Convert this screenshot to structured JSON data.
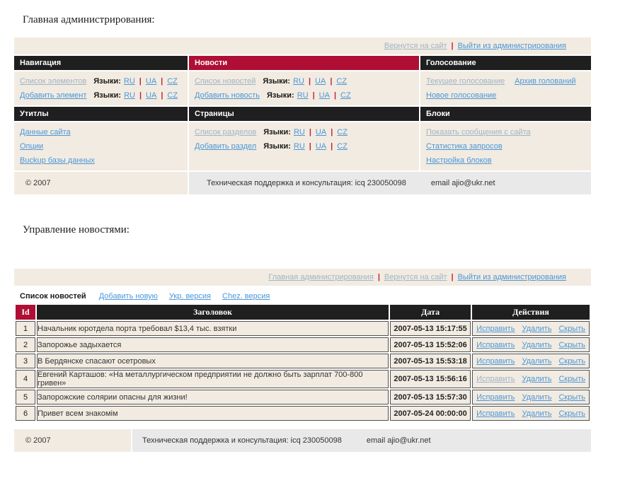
{
  "page": {
    "title_admin": "Главная администрирования:",
    "title_news": "Управление новостями:"
  },
  "colors": {
    "accent_red": "#af0e35",
    "header_dark": "#1f1f1f",
    "panel_beige": "#f2ebe1",
    "footer_gray": "#e9e9e9",
    "link_blue": "#4a97d9",
    "link_visited": "#9fb4c7",
    "separator_red": "#c0203a"
  },
  "admin_panel": {
    "topbar_links": [
      {
        "label": "Вернутся на сайт",
        "visited": true
      },
      {
        "label": "Выйти из администрирования",
        "visited": false
      }
    ],
    "languages_label": "Языки:",
    "section_rows": [
      [
        {
          "title": "Навигация",
          "accent": false,
          "items": [
            {
              "links": [
                {
                  "label": "Список элементов",
                  "visited": true
                }
              ],
              "languages": [
                "RU",
                "UA",
                "CZ"
              ]
            },
            {
              "links": [
                {
                  "label": "Добавить элемент",
                  "visited": false
                }
              ],
              "languages": [
                "RU",
                "UA",
                "CZ"
              ]
            }
          ]
        },
        {
          "title": "Новости",
          "accent": true,
          "items": [
            {
              "links": [
                {
                  "label": "Список новостей",
                  "visited": true
                }
              ],
              "languages": [
                "RU",
                "UA",
                "CZ"
              ]
            },
            {
              "links": [
                {
                  "label": "Добавить новость",
                  "visited": false
                }
              ],
              "languages": [
                "RU",
                "UA",
                "CZ"
              ]
            }
          ]
        },
        {
          "title": "Голосование",
          "accent": false,
          "items": [
            {
              "links": [
                {
                  "label": "Текущее голосование",
                  "visited": true
                },
                {
                  "label": "Архив голований",
                  "visited": false
                }
              ]
            },
            {
              "links": [
                {
                  "label": "Новое голосование",
                  "visited": false
                }
              ]
            }
          ]
        }
      ],
      [
        {
          "title": "Утитлы",
          "accent": false,
          "items": [
            {
              "links": [
                {
                  "label": "Данные сайта",
                  "visited": false
                }
              ]
            },
            {
              "links": [
                {
                  "label": "Опции",
                  "visited": false
                }
              ]
            },
            {
              "links": [
                {
                  "label": "Buckup базы данных",
                  "visited": false
                }
              ]
            }
          ]
        },
        {
          "title": "Страницы",
          "accent": false,
          "items": [
            {
              "links": [
                {
                  "label": "Список разделов",
                  "visited": true
                }
              ],
              "languages": [
                "RU",
                "UA",
                "CZ"
              ]
            },
            {
              "links": [
                {
                  "label": "Добавить раздел",
                  "visited": false
                }
              ],
              "languages": [
                "RU",
                "UA",
                "CZ"
              ]
            }
          ]
        },
        {
          "title": "Блоки",
          "accent": false,
          "items": [
            {
              "links": [
                {
                  "label": "Показать сообщения с сайта",
                  "visited": true
                }
              ]
            },
            {
              "links": [
                {
                  "label": "Статистика запросов",
                  "visited": false
                }
              ]
            },
            {
              "links": [
                {
                  "label": "Настройка блоков",
                  "visited": false
                }
              ]
            }
          ]
        }
      ]
    ],
    "footer": {
      "copyright": "© 2007",
      "support": "Техническая поддержка и консультация: icq 230050098",
      "email": "email ajio@ukr.net"
    }
  },
  "news_panel": {
    "topbar_links": [
      {
        "label": "Главная администрирования",
        "visited": true
      },
      {
        "label": "Вернутся на сайт",
        "visited": true
      },
      {
        "label": "Выйти из администрирования",
        "visited": false
      }
    ],
    "tabs": [
      {
        "label": "Список новостей",
        "active": true
      },
      {
        "label": "Добавить новую",
        "active": false
      },
      {
        "label": "Укр. версия",
        "active": false
      },
      {
        "label": "Chez. версия",
        "active": false
      }
    ],
    "table": {
      "headers": [
        "Id",
        "Заголовок",
        "Дата",
        "Действия"
      ],
      "rows": [
        {
          "id": "1",
          "title": "Начальник юротдела порта требовал $13,4 тыс. взятки",
          "date": "2007-05-13 15:17:55",
          "actions": [
            {
              "label": "Исправить",
              "visited": false
            },
            {
              "label": "Удалить",
              "visited": false
            },
            {
              "label": "Скрыть",
              "visited": false
            }
          ]
        },
        {
          "id": "2",
          "title": "Запорожье задыхается",
          "date": "2007-05-13 15:52:06",
          "actions": [
            {
              "label": "Исправить",
              "visited": false
            },
            {
              "label": "Удалить",
              "visited": false
            },
            {
              "label": "Скрыть",
              "visited": false
            }
          ]
        },
        {
          "id": "3",
          "title": "В Бердянске спасают осетровых",
          "date": "2007-05-13 15:53:18",
          "actions": [
            {
              "label": "Исправить",
              "visited": false
            },
            {
              "label": "Удалить",
              "visited": false
            },
            {
              "label": "Скрыть",
              "visited": false
            }
          ]
        },
        {
          "id": "4",
          "title": "Евгений Карташов: «На металлургическом предприятии не должно быть зарплат 700-800 гривен»",
          "date": "2007-05-13 15:56:16",
          "actions": [
            {
              "label": "Исправить",
              "visited": true
            },
            {
              "label": "Удалить",
              "visited": false
            },
            {
              "label": "Скрыть",
              "visited": false
            }
          ]
        },
        {
          "id": "5",
          "title": "Запорожские солярии опасны для жизни!",
          "date": "2007-05-13 15:57:30",
          "actions": [
            {
              "label": "Исправить",
              "visited": false
            },
            {
              "label": "Удалить",
              "visited": false
            },
            {
              "label": "Скрыть",
              "visited": false
            }
          ]
        },
        {
          "id": "6",
          "title": "Привет всем знакомім",
          "date": "2007-05-24 00:00:00",
          "actions": [
            {
              "label": "Исправить",
              "visited": false
            },
            {
              "label": "Удалить",
              "visited": false
            },
            {
              "label": "Скрыть",
              "visited": false
            }
          ]
        }
      ]
    },
    "footer": {
      "copyright": "© 2007",
      "support": "Техническая поддержка и консультация: icq 230050098",
      "email": "email ajio@ukr.net"
    }
  }
}
